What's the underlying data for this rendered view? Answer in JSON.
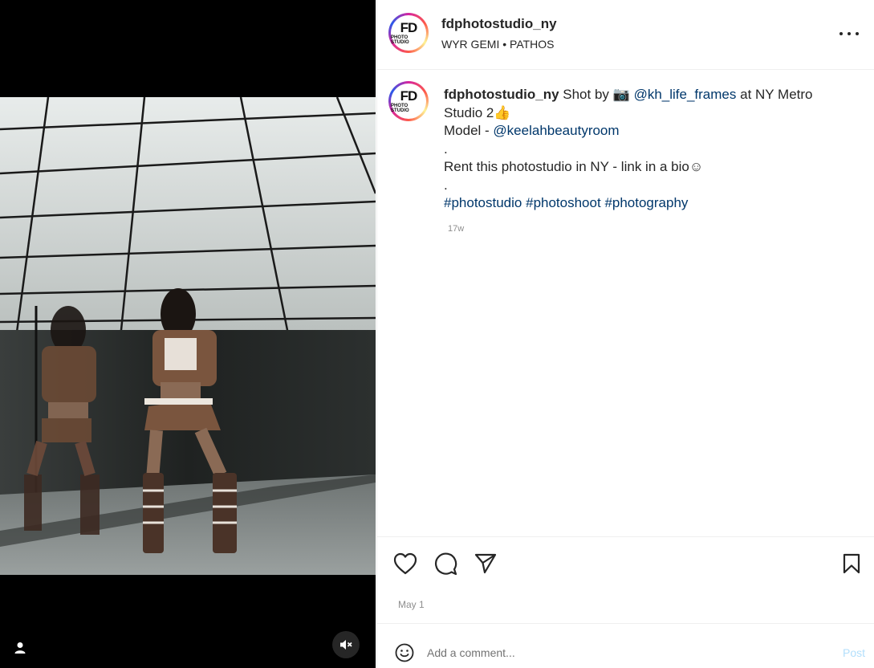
{
  "post": {
    "username": "fdphotostudio_ny",
    "audio_artist": "WYR GEMI",
    "audio_separator": "•",
    "audio_track": "PATHOS",
    "avatar_text_big": "FD",
    "avatar_text_small": "PHOTO STUDIO",
    "caption": {
      "username": "fdphotostudio_ny",
      "shot_by": "Shot by",
      "camera_emoji": "📷",
      "photographer": "@kh_life_frames",
      "location_text": "at NY Metro Studio 2",
      "thumb_emoji": "👍",
      "model_label": "Model -",
      "model_handle": "@keelahbeautyroom",
      "dot1": ".",
      "rent_text": "Rent this photostudio in NY - link in a bio",
      "smile_emoji": "☺",
      "dot2": ".",
      "hashtags": [
        "#photostudio",
        "#photoshoot",
        "#photography"
      ],
      "time_ago": "17w"
    },
    "date": "May 1"
  },
  "icons": {
    "like": "heart-icon",
    "comment": "comment-bubble-icon",
    "share": "paper-plane-icon",
    "save": "bookmark-icon",
    "more": "more-dots-icon",
    "mute": "speaker-muted-icon",
    "user_tag": "person-icon",
    "emoji": "emoji-smile-icon"
  },
  "comment_box": {
    "placeholder": "Add a comment...",
    "post_label": "Post",
    "post_color": "#b2dffc"
  },
  "colors": {
    "link": "#00376b",
    "text": "#262626",
    "muted": "#8e8e8e"
  }
}
